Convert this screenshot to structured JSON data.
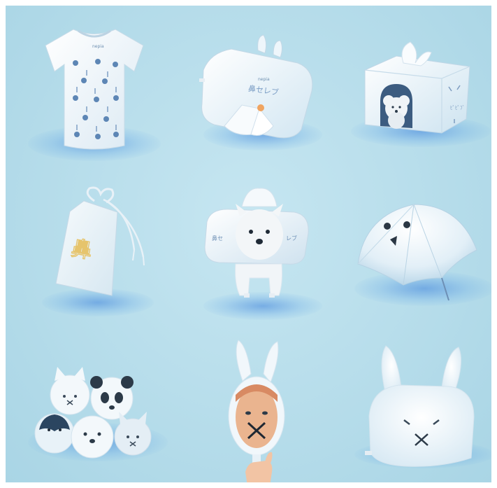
{
  "tshirt": {
    "tag": "nepia"
  },
  "pillow": {
    "brand": "nepia",
    "product": "鼻セレブ"
  },
  "tissue_box": {
    "label": "ﾋﾟﾋﾟﾌﾞ"
  },
  "omamori": {
    "kanji": "鼻"
  },
  "dog": {
    "left_text": "鼻セ",
    "right_text": "レブ"
  }
}
